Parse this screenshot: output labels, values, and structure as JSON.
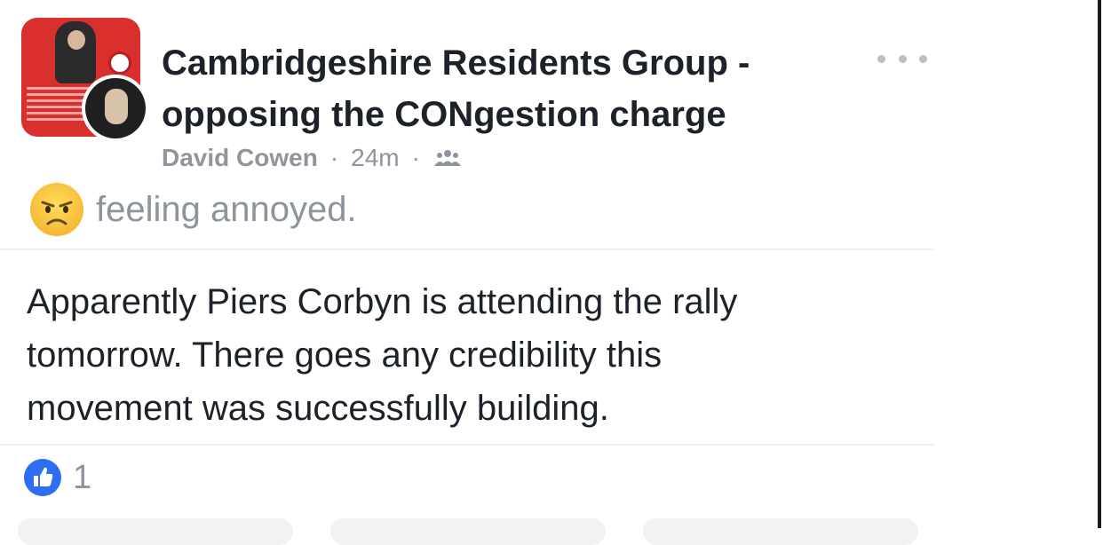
{
  "post": {
    "group_name": "Cambridgeshire Residents Group - opposing the CONgestion charge",
    "author": "David Cowen",
    "time": "24m",
    "separator": "·",
    "audience_icon": "members-icon",
    "more_icon": "more-options-icon",
    "feeling": {
      "icon": "annoyed-face-icon",
      "text": "feeling annoyed."
    },
    "body": "Apparently Piers Corbyn is attending the rally\ntomorrow.  There goes any credibility this\nmovement was successfully building.",
    "reactions": {
      "icon": "like-icon",
      "count": "1"
    }
  },
  "colors": {
    "group_avatar_red": "#d9302e",
    "like_blue": "#2d6ff3",
    "text_primary": "#1d2129",
    "text_secondary": "#8d949e"
  }
}
